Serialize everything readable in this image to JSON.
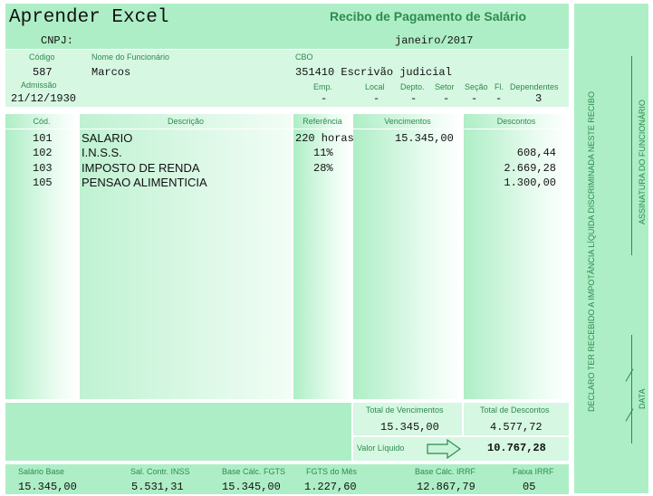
{
  "header": {
    "company": "Aprender Excel",
    "title": "Recibo de Pagamento de Salário",
    "cnpj_label": "CNPJ:",
    "period": "janeiro/2017"
  },
  "employee": {
    "code_label": "Código",
    "code": "587",
    "name_label": "Nome do Funcionário",
    "name": "Marcos",
    "cbo_label": "CBO",
    "cbo": "351410 Escrivão judicial",
    "admission_label": "Admissão",
    "admission": "21/12/1930",
    "emp_label": "Emp.",
    "emp": "-",
    "local_label": "Local",
    "local": "-",
    "depto_label": "Depto.",
    "depto": "-",
    "setor_label": "Setor",
    "setor": "-",
    "secao_label": "Seção",
    "secao": "-",
    "fl_label": "Fl.",
    "fl": "-",
    "dependentes_label": "Dependentes",
    "dependentes": "3"
  },
  "table": {
    "headers": {
      "cod": "Cód.",
      "descricao": "Descrição",
      "referencia": "Referência",
      "vencimentos": "Vencimentos",
      "descontos": "Descontos"
    },
    "rows": [
      {
        "cod": "101",
        "descricao": "SALARIO",
        "referencia": "220 horas",
        "vencimentos": "15.345,00",
        "descontos": ""
      },
      {
        "cod": "102",
        "descricao": "I.N.S.S.",
        "referencia": "11%",
        "vencimentos": "",
        "descontos": "608,44"
      },
      {
        "cod": "103",
        "descricao": "IMPOSTO DE RENDA",
        "referencia": "28%",
        "vencimentos": "",
        "descontos": "2.669,28"
      },
      {
        "cod": "105",
        "descricao": "PENSAO ALIMENTICIA",
        "referencia": "",
        "vencimentos": "",
        "descontos": "1.300,00"
      }
    ]
  },
  "totals": {
    "total_vencimentos_label": "Total de Vencimentos",
    "total_vencimentos": "15.345,00",
    "total_descontos_label": "Total de Descontos",
    "total_descontos": "4.577,72",
    "liquido_label": "Valor Líquido",
    "liquido": "10.767,28"
  },
  "footer": {
    "salario_base_label": "Salário Base",
    "salario_base": "15.345,00",
    "sal_contr_inss_label": "Sal. Contr. INSS",
    "sal_contr_inss": "5.531,31",
    "base_fgts_label": "Base Cálc. FGTS",
    "base_fgts": "15.345,00",
    "fgts_mes_label": "FGTS do Mês",
    "fgts_mes": "1.227,60",
    "base_irrf_label": "Base Cálc. IRRF",
    "base_irrf": "12.867,79",
    "faixa_irrf_label": "Faixa IRRF",
    "faixa_irrf": "05"
  },
  "side": {
    "declaration": "DECLARO TER RECEBIDO  A IMPOTÂNCIA LÍQUIDA DISCRIMINADA NESTE RECIBO",
    "signature_label": "ASSINATURA DO FUNCIONÁRIO",
    "date_label": "DATA"
  },
  "colors": {
    "accent": "#2e8b4e",
    "band": "#aeeec6",
    "light": "#d6f7e2"
  }
}
